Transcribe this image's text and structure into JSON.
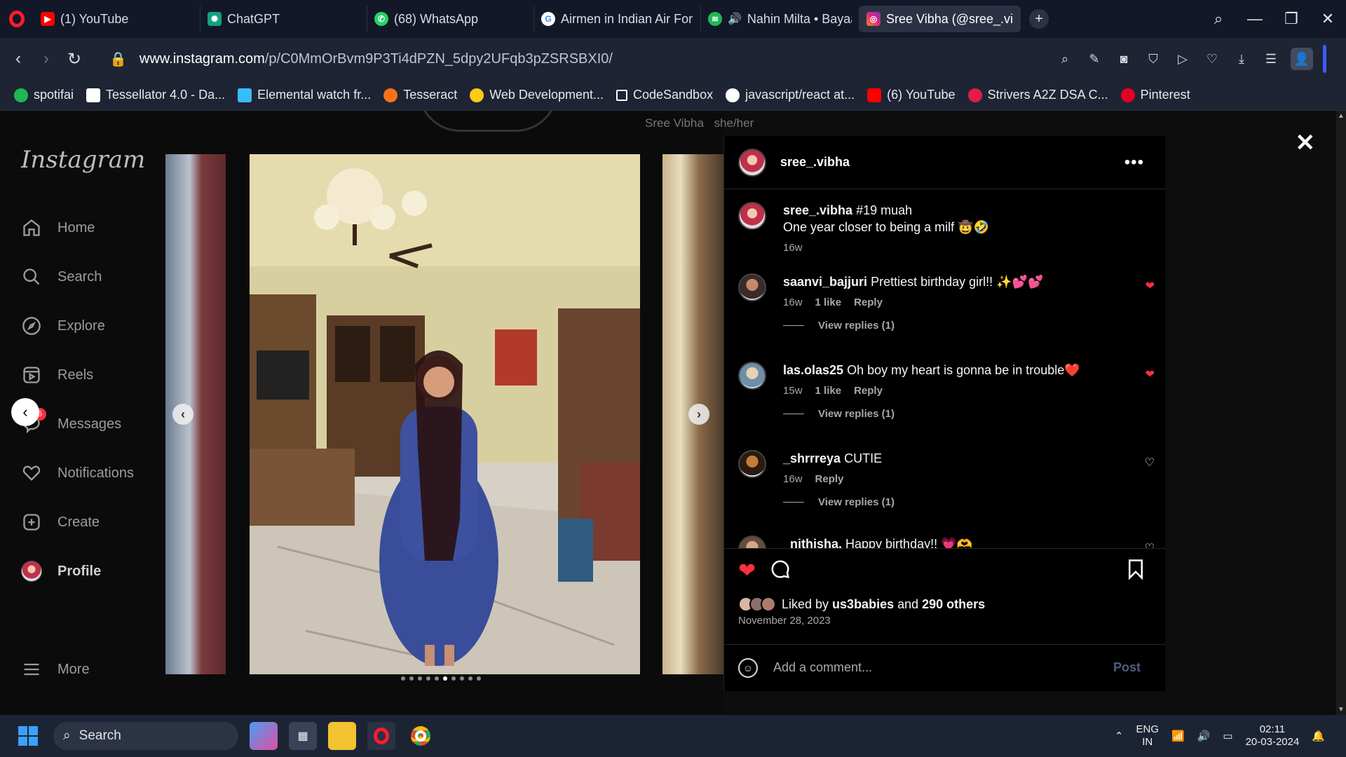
{
  "browser": {
    "tabs": [
      {
        "label": "(1) YouTube",
        "favicon": "youtube-icon",
        "color": "#ff0000",
        "active": false
      },
      {
        "label": "ChatGPT",
        "favicon": "chatgpt-icon",
        "color": "#10a37f",
        "active": false
      },
      {
        "label": "(68) WhatsApp",
        "favicon": "whatsapp-icon",
        "color": "#25d366",
        "active": false
      },
      {
        "label": "Airmen in Indian Air Forc",
        "favicon": "google-icon",
        "color": "#4285f4",
        "active": false
      },
      {
        "label": "Nahin Milta • Bayaan",
        "favicon": "spotify-icon",
        "color": "#1db954",
        "active": false
      },
      {
        "label": "Sree Vibha (@sree_.vibh",
        "favicon": "instagram-icon",
        "color": "#e1306c",
        "active": true
      }
    ],
    "url": "www.instagram.com/p/C0MmOrBvm9P3Ti4dPZN_5dpy2UFqb3pZSRSBXI0/",
    "url_domain": "www.instagram.com",
    "url_path": "/p/C0MmOrBvm9P3Ti4dPZN_5dpy2UFqb3pZSRSBXI0/",
    "bookmarks": [
      {
        "label": "spotifai",
        "color": "#1db954"
      },
      {
        "label": "Tessellator 4.0 - Da...",
        "color": "#ffffff"
      },
      {
        "label": "Elemental watch fr...",
        "color": "#38bdf8"
      },
      {
        "label": "Tesseract",
        "color": "#f97316"
      },
      {
        "label": "Web Development...",
        "color": "#facc15"
      },
      {
        "label": "CodeSandbox",
        "color": "#ffffff"
      },
      {
        "label": "javascript/react at...",
        "color": "#ffffff"
      },
      {
        "label": "(6) YouTube",
        "color": "#ff0000"
      },
      {
        "label": "Strivers A2Z DSA C...",
        "color": "#e11d48"
      },
      {
        "label": "Pinterest",
        "color": "#e60023"
      }
    ]
  },
  "instagram": {
    "logo": "Instagram",
    "nav": [
      {
        "label": "Home",
        "icon": "home-icon"
      },
      {
        "label": "Search",
        "icon": "search-icon"
      },
      {
        "label": "Explore",
        "icon": "compass-icon"
      },
      {
        "label": "Reels",
        "icon": "reels-icon"
      },
      {
        "label": "Messages",
        "icon": "messenger-icon"
      },
      {
        "label": "Notifications",
        "icon": "heart-icon"
      },
      {
        "label": "Create",
        "icon": "plus-square-icon"
      },
      {
        "label": "Profile",
        "icon": "avatar"
      },
      {
        "label": "More",
        "icon": "menu-icon"
      }
    ],
    "messages_badge": "5",
    "ghost_name": "Sree Vibha",
    "ghost_pronoun": "she/her",
    "carousel": {
      "total": 10,
      "current_index": 5
    }
  },
  "post": {
    "username": "sree_.vibha",
    "caption_user": "sree_.vibha",
    "caption_text": " #19 muah",
    "caption_line2": "One year closer to being a milf 🤠🤣",
    "caption_time": "16w",
    "comments": [
      {
        "user": "saanvi_bajjuri",
        "text": " Prettiest birthday girl!! ✨💕💕",
        "time": "16w",
        "likes": "1 like",
        "reply": "Reply",
        "liked": true,
        "replies": "View replies (1)"
      },
      {
        "user": "las.olas25",
        "text": " Oh boy my heart is gonna be in trouble❤️",
        "time": "15w",
        "likes": "1 like",
        "reply": "Reply",
        "liked": true,
        "replies": "View replies (1)"
      },
      {
        "user": "_shrrreya",
        "text": " CUTIE",
        "time": "16w",
        "likes": "",
        "reply": "Reply",
        "liked": false,
        "replies": "View replies (1)"
      },
      {
        "user": "_nithisha.",
        "text": "  Happy birthday!! 💗🫶",
        "time": "",
        "likes": "",
        "reply": "",
        "liked": false,
        "replies": ""
      }
    ],
    "liked_by_prefix": "Liked by ",
    "liked_by_user": "us3babies",
    "liked_by_mid": " and ",
    "liked_by_others": "290 others",
    "date": "November 28, 2023",
    "comment_placeholder": "Add a comment...",
    "post_label": "Post"
  },
  "taskbar": {
    "search_label": "Search",
    "lang_top": "ENG",
    "lang_bottom": "IN",
    "time": "02:11",
    "date": "20-03-2024"
  }
}
